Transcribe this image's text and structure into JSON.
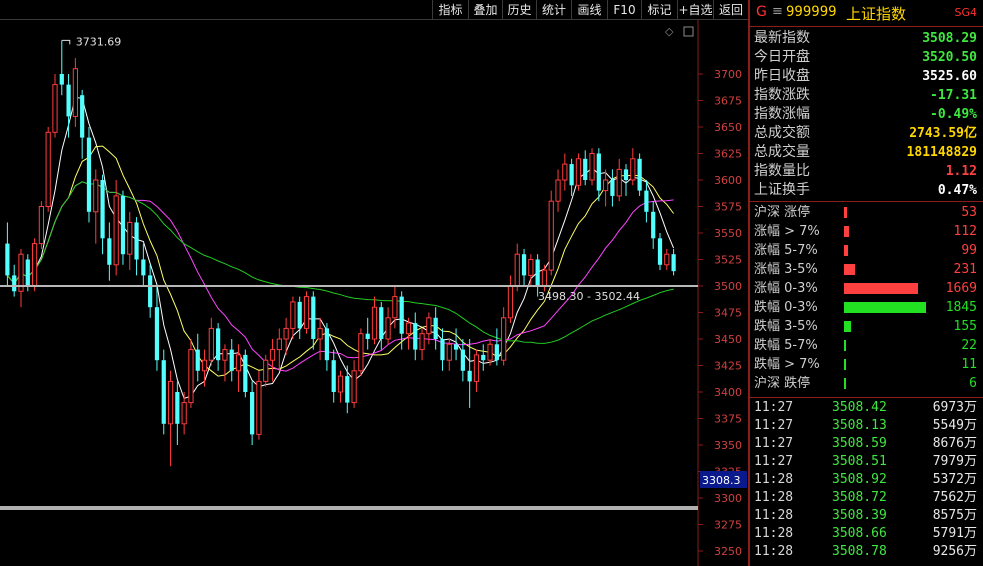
{
  "toolbar": {
    "items": [
      "指标",
      "叠加",
      "历史",
      "统计",
      "画线",
      "F10",
      "标记",
      "+自选",
      "返回"
    ]
  },
  "chart": {
    "high_label": "3731.69",
    "range_label": "3498.30 - 3502.44",
    "price_tag": "3308.3",
    "y_ticks": [
      3700,
      3675,
      3650,
      3625,
      3600,
      3575,
      3550,
      3525,
      3500,
      3475,
      3450,
      3425,
      3400,
      3375,
      3350,
      3325,
      3300,
      3275,
      3250
    ],
    "colors": {
      "up": "#ff3c3c",
      "down": "#54ffff",
      "ma5": "#ffffff",
      "ma10": "#ffff66",
      "ma20": "#ff44ff",
      "ma60": "#22cc22"
    }
  },
  "chart_data": {
    "type": "candlestick",
    "ylim": [
      3240,
      3740
    ],
    "ohlc": [
      [
        3540,
        3560,
        3500,
        3510
      ],
      [
        3510,
        3520,
        3490,
        3495
      ],
      [
        3495,
        3535,
        3480,
        3530
      ],
      [
        3525,
        3530,
        3495,
        3500
      ],
      [
        3500,
        3545,
        3495,
        3540
      ],
      [
        3540,
        3580,
        3535,
        3575
      ],
      [
        3575,
        3650,
        3570,
        3645
      ],
      [
        3645,
        3700,
        3640,
        3690
      ],
      [
        3700,
        3731.69,
        3680,
        3690
      ],
      [
        3690,
        3700,
        3640,
        3660
      ],
      [
        3660,
        3715,
        3650,
        3705
      ],
      [
        3680,
        3685,
        3620,
        3640
      ],
      [
        3640,
        3650,
        3560,
        3570
      ],
      [
        3570,
        3610,
        3540,
        3600
      ],
      [
        3600,
        3605,
        3530,
        3545
      ],
      [
        3545,
        3560,
        3505,
        3520
      ],
      [
        3520,
        3600,
        3510,
        3585
      ],
      [
        3585,
        3590,
        3520,
        3530
      ],
      [
        3530,
        3570,
        3515,
        3560
      ],
      [
        3560,
        3565,
        3510,
        3525
      ],
      [
        3525,
        3540,
        3500,
        3510
      ],
      [
        3510,
        3520,
        3470,
        3480
      ],
      [
        3480,
        3500,
        3420,
        3430
      ],
      [
        3430,
        3440,
        3360,
        3370
      ],
      [
        3370,
        3420,
        3330,
        3410
      ],
      [
        3400,
        3410,
        3350,
        3370
      ],
      [
        3370,
        3400,
        3360,
        3390
      ],
      [
        3390,
        3450,
        3385,
        3440
      ],
      [
        3440,
        3455,
        3410,
        3420
      ],
      [
        3420,
        3440,
        3405,
        3430
      ],
      [
        3430,
        3470,
        3425,
        3460
      ],
      [
        3460,
        3465,
        3420,
        3430
      ],
      [
        3430,
        3445,
        3410,
        3440
      ],
      [
        3440,
        3450,
        3410,
        3420
      ],
      [
        3420,
        3445,
        3400,
        3435
      ],
      [
        3435,
        3440,
        3395,
        3400
      ],
      [
        3400,
        3410,
        3350,
        3360
      ],
      [
        3360,
        3420,
        3355,
        3410
      ],
      [
        3410,
        3435,
        3405,
        3430
      ],
      [
        3430,
        3450,
        3410,
        3440
      ],
      [
        3440,
        3460,
        3420,
        3450
      ],
      [
        3450,
        3470,
        3435,
        3460
      ],
      [
        3460,
        3490,
        3450,
        3485
      ],
      [
        3485,
        3490,
        3450,
        3460
      ],
      [
        3460,
        3495,
        3455,
        3490
      ],
      [
        3490,
        3495,
        3440,
        3450
      ],
      [
        3450,
        3470,
        3430,
        3460
      ],
      [
        3460,
        3465,
        3420,
        3430
      ],
      [
        3430,
        3440,
        3390,
        3400
      ],
      [
        3400,
        3420,
        3390,
        3415
      ],
      [
        3415,
        3425,
        3380,
        3390
      ],
      [
        3390,
        3430,
        3385,
        3420
      ],
      [
        3420,
        3460,
        3415,
        3455
      ],
      [
        3455,
        3470,
        3440,
        3450
      ],
      [
        3450,
        3490,
        3445,
        3480
      ],
      [
        3480,
        3485,
        3440,
        3450
      ],
      [
        3450,
        3480,
        3445,
        3470
      ],
      [
        3470,
        3500,
        3460,
        3490
      ],
      [
        3490,
        3495,
        3440,
        3455
      ],
      [
        3455,
        3470,
        3440,
        3465
      ],
      [
        3465,
        3475,
        3430,
        3440
      ],
      [
        3440,
        3460,
        3430,
        3455
      ],
      [
        3455,
        3475,
        3445,
        3470
      ],
      [
        3470,
        3480,
        3440,
        3450
      ],
      [
        3450,
        3460,
        3420,
        3430
      ],
      [
        3430,
        3450,
        3420,
        3445
      ],
      [
        3445,
        3460,
        3430,
        3440
      ],
      [
        3440,
        3450,
        3410,
        3420
      ],
      [
        3420,
        3450,
        3385,
        3410
      ],
      [
        3410,
        3440,
        3400,
        3435
      ],
      [
        3435,
        3445,
        3420,
        3430
      ],
      [
        3430,
        3450,
        3425,
        3445
      ],
      [
        3445,
        3460,
        3425,
        3430
      ],
      [
        3430,
        3480,
        3425,
        3470
      ],
      [
        3470,
        3510,
        3465,
        3500
      ],
      [
        3500,
        3540,
        3495,
        3530
      ],
      [
        3530,
        3535,
        3500,
        3510
      ],
      [
        3510,
        3530,
        3500,
        3525
      ],
      [
        3525,
        3530,
        3490,
        3500
      ],
      [
        3500,
        3520,
        3495,
        3515
      ],
      [
        3515,
        3590,
        3510,
        3580
      ],
      [
        3580,
        3610,
        3570,
        3600
      ],
      [
        3600,
        3625,
        3590,
        3615
      ],
      [
        3615,
        3620,
        3585,
        3595
      ],
      [
        3595,
        3625,
        3590,
        3620
      ],
      [
        3620,
        3628,
        3595,
        3600
      ],
      [
        3600,
        3630,
        3595,
        3625
      ],
      [
        3625,
        3630,
        3580,
        3590
      ],
      [
        3590,
        3610,
        3575,
        3600
      ],
      [
        3600,
        3610,
        3575,
        3585
      ],
      [
        3585,
        3620,
        3580,
        3610
      ],
      [
        3610,
        3615,
        3585,
        3600
      ],
      [
        3600,
        3630,
        3595,
        3620
      ],
      [
        3620,
        3625,
        3585,
        3590
      ],
      [
        3590,
        3600,
        3560,
        3570
      ],
      [
        3570,
        3580,
        3535,
        3545
      ],
      [
        3545,
        3550,
        3515,
        3520
      ],
      [
        3520,
        3535,
        3515,
        3530
      ],
      [
        3530,
        3535,
        3510,
        3514
      ]
    ],
    "ma_series": [
      "MA5",
      "MA10",
      "MA20",
      "MA60"
    ]
  },
  "quote": {
    "g_label": "G",
    "menu_icon": "≡",
    "code": "999999",
    "name": "上证指数",
    "tag": "SG4",
    "rows": [
      {
        "label": "最新指数",
        "value": "3508.29",
        "color": "#3ee83e"
      },
      {
        "label": "今日开盘",
        "value": "3520.50",
        "color": "#3ee83e"
      },
      {
        "label": "昨日收盘",
        "value": "3525.60",
        "color": "#ffffff"
      },
      {
        "label": "指数涨跌",
        "value": "-17.31",
        "color": "#3ee83e"
      },
      {
        "label": "指数涨幅",
        "value": "-0.49%",
        "color": "#3ee83e"
      },
      {
        "label": "总成交额",
        "value": "2743.59亿",
        "color": "#ffd700"
      },
      {
        "label": "总成交量",
        "value": "181148829",
        "color": "#ffd700"
      },
      {
        "label": "指数量比",
        "value": "1.12",
        "color": "#ff4040"
      },
      {
        "label": "上证换手",
        "value": "0.47%",
        "color": "#ffffff"
      }
    ]
  },
  "distribution": [
    {
      "label": "沪深 涨停",
      "value": "53",
      "color": "#ff4040",
      "bar_frac": 0.04
    },
    {
      "label": "涨幅 > 7%",
      "value": "112",
      "color": "#ff4040",
      "bar_frac": 0.06
    },
    {
      "label": "涨幅 5-7%",
      "value": "99",
      "color": "#ff4040",
      "bar_frac": 0.05
    },
    {
      "label": "涨幅 3-5%",
      "value": "231",
      "color": "#ff4040",
      "bar_frac": 0.13
    },
    {
      "label": "涨幅 0-3%",
      "value": "1669",
      "color": "#ff4040",
      "bar_frac": 0.9
    },
    {
      "label": "跌幅 0-3%",
      "value": "1845",
      "color": "#22e022",
      "bar_frac": 1.0
    },
    {
      "label": "跌幅 3-5%",
      "value": "155",
      "color": "#22e022",
      "bar_frac": 0.08
    },
    {
      "label": "跌幅 5-7%",
      "value": "22",
      "color": "#22e022",
      "bar_frac": 0.012
    },
    {
      "label": "跌幅 > 7%",
      "value": "11",
      "color": "#22e022",
      "bar_frac": 0.01
    },
    {
      "label": "沪深 跌停",
      "value": "6",
      "color": "#22e022",
      "bar_frac": 0.008
    }
  ],
  "ticks": [
    {
      "time": "11:27",
      "price": "3508.42",
      "vol": "6973万"
    },
    {
      "time": "11:27",
      "price": "3508.13",
      "vol": "5549万"
    },
    {
      "time": "11:27",
      "price": "3508.59",
      "vol": "8676万"
    },
    {
      "time": "11:27",
      "price": "3508.51",
      "vol": "7979万"
    },
    {
      "time": "11:28",
      "price": "3508.92",
      "vol": "5372万"
    },
    {
      "time": "11:28",
      "price": "3508.72",
      "vol": "7562万"
    },
    {
      "time": "11:28",
      "price": "3508.39",
      "vol": "8575万"
    },
    {
      "time": "11:28",
      "price": "3508.66",
      "vol": "5791万"
    },
    {
      "time": "11:28",
      "price": "3508.78",
      "vol": "9256万"
    }
  ]
}
